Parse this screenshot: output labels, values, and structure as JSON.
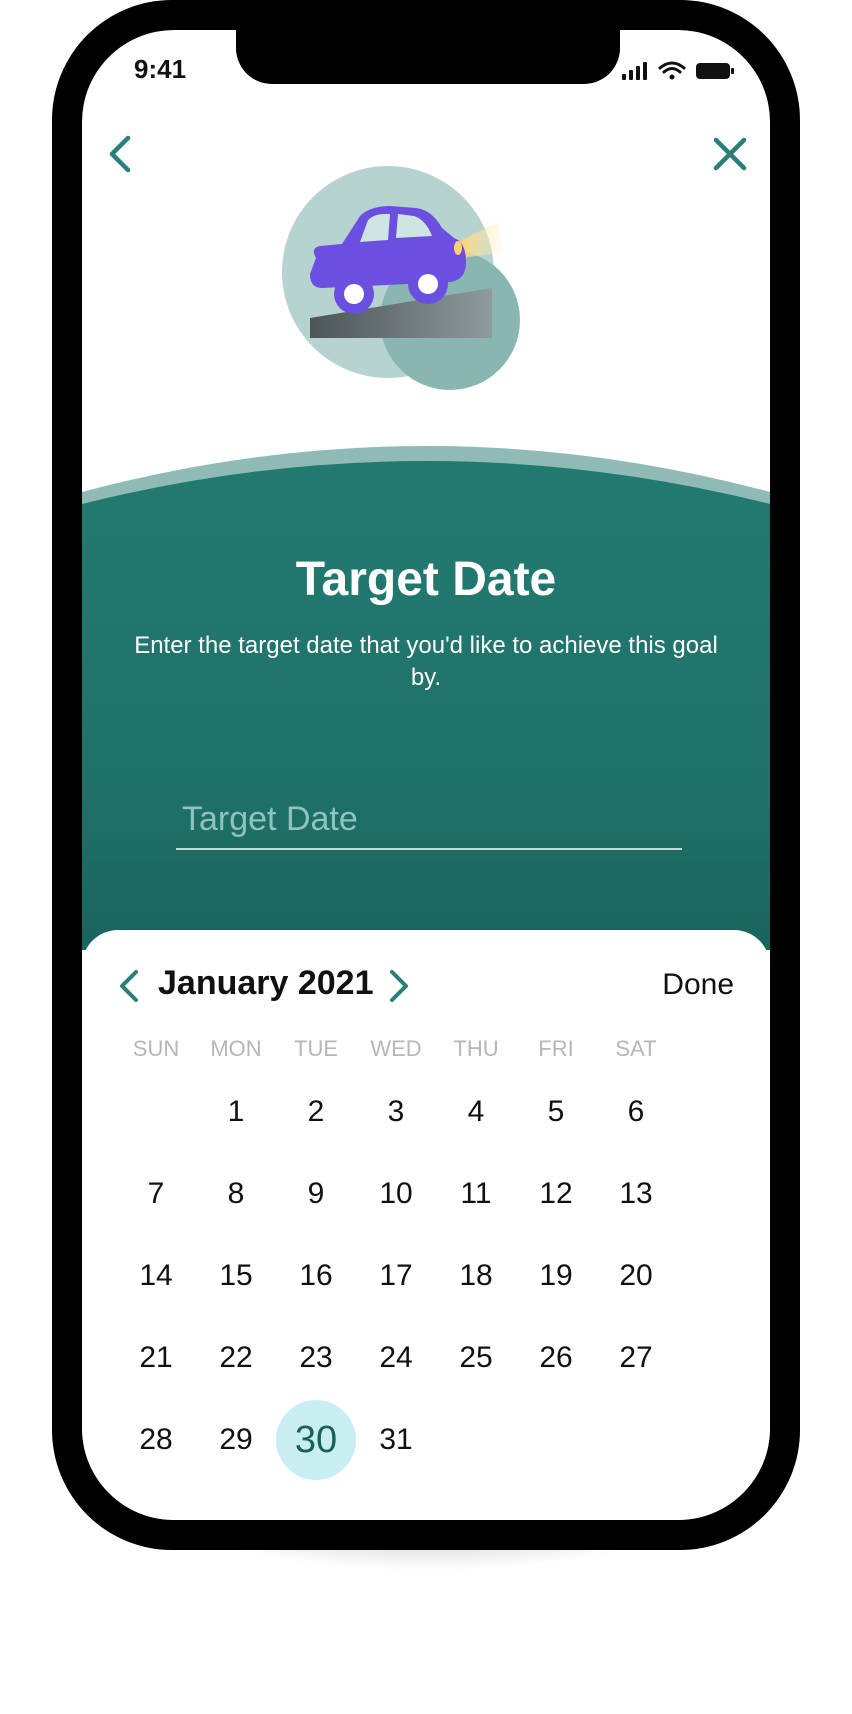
{
  "status_bar": {
    "time": "9:41",
    "icons": [
      "signal-icon",
      "wifi-icon",
      "battery-icon"
    ]
  },
  "nav": {
    "back_icon": "chevron-left-icon",
    "close_icon": "close-icon"
  },
  "illustration": {
    "icon": "car-on-ramp-illustration"
  },
  "header": {
    "title": "Target Date",
    "subtitle": "Enter the target date that you'd like to achieve this goal by."
  },
  "input": {
    "placeholder": "Target Date",
    "value": ""
  },
  "calendar": {
    "month_label": "January 2021",
    "done_label": "Done",
    "prev_icon": "chevron-left-icon",
    "next_icon": "chevron-right-icon",
    "weekdays": [
      "SUN",
      "MON",
      "TUE",
      "WED",
      "THU",
      "FRI",
      "SAT"
    ],
    "first_weekday_index": 1,
    "days": [
      "1",
      "2",
      "3",
      "4",
      "5",
      "6",
      "7",
      "8",
      "9",
      "10",
      "11",
      "12",
      "13",
      "14",
      "15",
      "16",
      "17",
      "18",
      "19",
      "20",
      "21",
      "22",
      "23",
      "24",
      "25",
      "26",
      "27",
      "28",
      "29",
      "30",
      "31"
    ],
    "selected_day": "30"
  },
  "colors": {
    "teal": "#22796f",
    "accent": "#2a7f77",
    "selected_bg": "#c9eef1",
    "car": "#6a4fe0"
  }
}
